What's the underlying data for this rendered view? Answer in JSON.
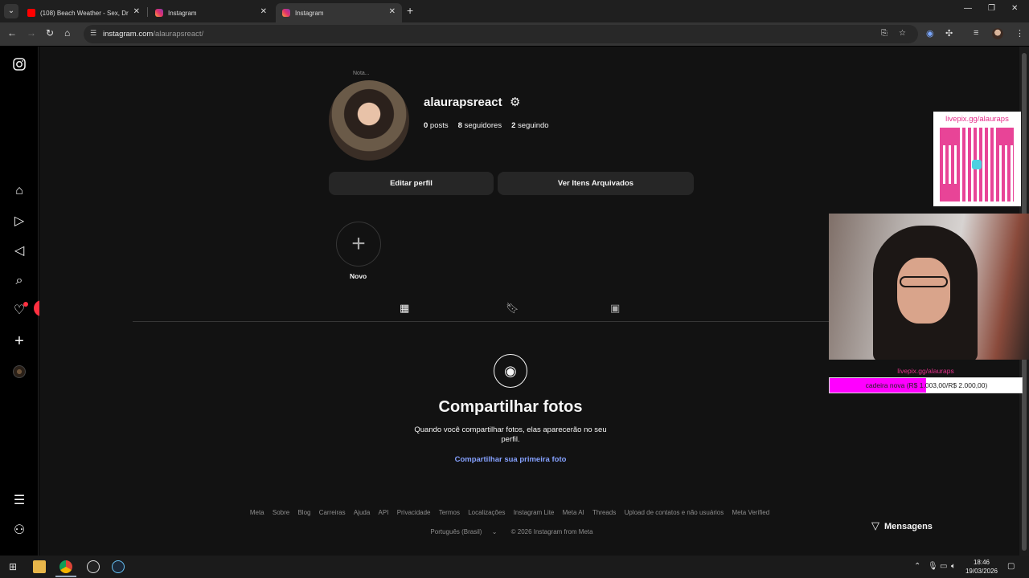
{
  "browser": {
    "tabs": [
      {
        "title": "(108) Beach Weather - Sex, Drugs",
        "favicon": "youtube-icon"
      },
      {
        "title": "Instagram",
        "favicon": "instagram-icon"
      },
      {
        "title": "Instagram",
        "favicon": "instagram-icon",
        "active": true
      }
    ],
    "url_host": "instagram.com",
    "url_path": "/alaurapsreact/"
  },
  "sidebar": {
    "notification_count": "1"
  },
  "profile": {
    "note_label": "Nota...",
    "username": "alaurapsreact",
    "posts_count": "0",
    "posts_label": " posts",
    "followers_count": "8",
    "followers_label": " seguidores",
    "following_count": "2",
    "following_label": " seguindo",
    "edit_button": "Editar perfil",
    "archive_button": "Ver Itens Arquivados",
    "new_highlight_label": "Novo"
  },
  "empty_state": {
    "title": "Compartilhar fotos",
    "description": "Quando você compartilhar fotos, elas aparecerão no seu perfil.",
    "link": "Compartilhar sua primeira foto"
  },
  "footer": {
    "links": [
      "Meta",
      "Sobre",
      "Blog",
      "Carreiras",
      "Ajuda",
      "API",
      "Privacidade",
      "Termos",
      "Localizações",
      "Instagram Lite",
      "Meta AI",
      "Threads",
      "Upload de contatos e não usuários",
      "Meta Verified"
    ],
    "language": "Português (Brasil)",
    "copyright": "© 2026 Instagram from Meta"
  },
  "messages": {
    "label": "Mensagens"
  },
  "overlay": {
    "qr_link": "livepix.gg/alauraps",
    "pix_link": "livepix.gg/alauraps",
    "goal_text": "cadeira nova (R$ 1.003,00/R$ 2.000,00)",
    "goal_progress": 0.5015
  },
  "taskbar": {
    "time": "18:46",
    "date": "19/03/2026"
  },
  "colors": {
    "accent_link": "#85a1ff",
    "notification": "#ff3040",
    "livepix_pink": "#e6308c"
  }
}
